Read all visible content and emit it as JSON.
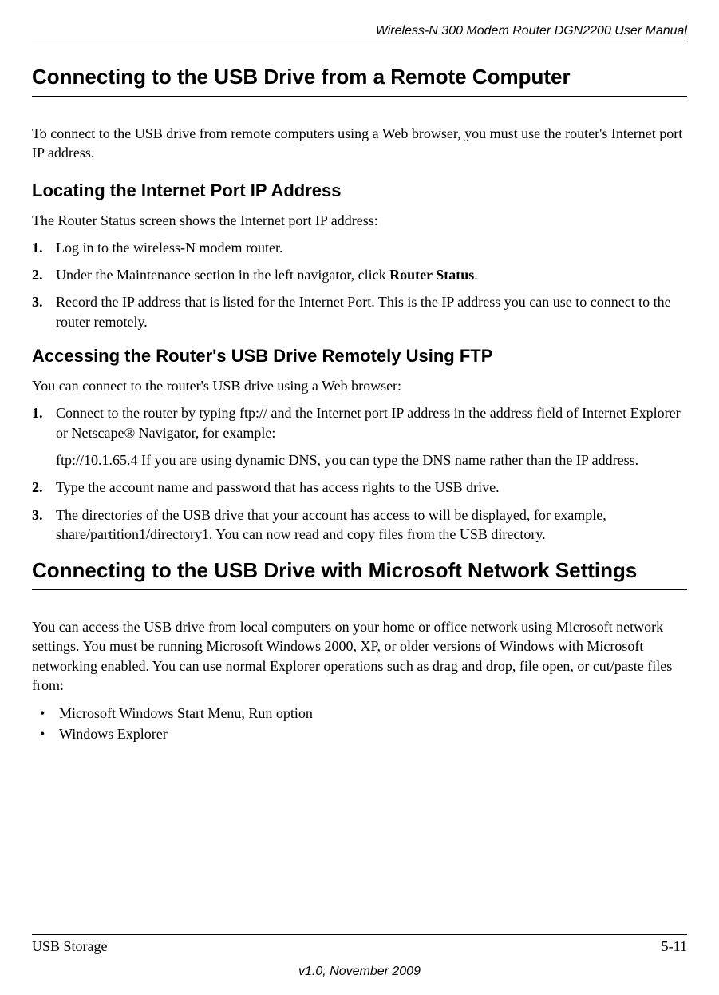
{
  "header": {
    "title": "Wireless-N 300 Modem Router DGN2200 User Manual"
  },
  "section1": {
    "heading": "Connecting to the USB Drive from a Remote Computer",
    "intro": "To connect to the USB drive from remote computers using a Web browser, you must use the router's Internet port IP address."
  },
  "section1_1": {
    "heading": "Locating the Internet Port IP Address",
    "lead": "The Router Status screen shows the Internet port IP address:",
    "steps": [
      "Log in to the wireless-N modem router.",
      "Under the Maintenance section in the left navigator, click ",
      "Record the IP address that is listed for the Internet Port. This is the IP address you can use to connect to the router remotely."
    ],
    "step2_bold": "Router Status",
    "step2_suffix": "."
  },
  "section1_2": {
    "heading": "Accessing the Router's USB Drive Remotely Using FTP",
    "lead": "You can connect to the router's USB drive using a Web browser:",
    "step1_main": "Connect to the router by typing ftp:// and the Internet port IP address in the address field of Internet Explorer or Netscape® Navigator, for example:",
    "step1_sub": "ftp://10.1.65.4 If you are using dynamic DNS, you can type the DNS name rather than the IP address.",
    "step2": "Type the account name and password that has access rights to the USB drive.",
    "step3": "The directories of the USB drive that your account has access to will be displayed, for example, share/partition1/directory1. You can now read and copy files from the USB directory."
  },
  "section2": {
    "heading": "Connecting to the USB Drive with Microsoft Network Settings",
    "intro": "You can access the USB drive from local computers on your home or office network using Microsoft network settings. You must be running Microsoft Windows 2000, XP, or older versions of Windows with Microsoft networking enabled. You can use normal Explorer operations such as drag and drop, file open, or cut/paste files from:",
    "bullets": [
      "Microsoft Windows Start Menu, Run option",
      "Windows Explorer"
    ]
  },
  "footer": {
    "left": "USB Storage",
    "right": "5-11",
    "center": "v1.0, November 2009"
  }
}
